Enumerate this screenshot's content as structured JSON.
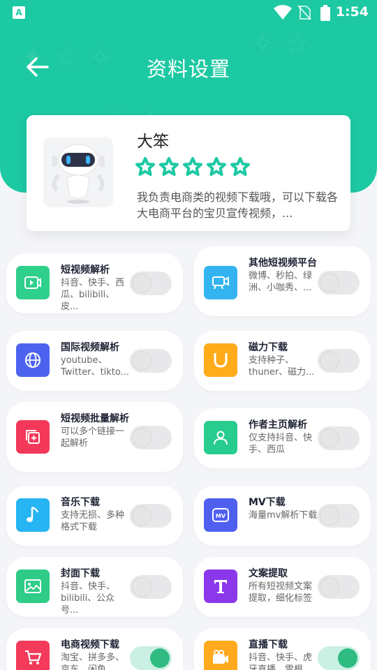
{
  "status_bar": {
    "time": "1:54",
    "app_badge": "A"
  },
  "header": {
    "title": "资料设置"
  },
  "profile": {
    "name": "大笨",
    "rating": 5,
    "description": "我负责电商类的视频下载哦，可以下载各大电商平台的宝贝宣传视频，..."
  },
  "colors": {
    "accent": "#1dc9a2",
    "toggle_on": "#2fbb82"
  },
  "features": [
    {
      "title": "短视频解析",
      "desc": "抖音、快手、西瓜、bilibili、皮...",
      "icon": "video-play-icon",
      "color": "#2fcf8c",
      "enabled": false
    },
    {
      "title": "其他短视频平台",
      "desc": "微博、秒拍、绿洲、小咖秀、...",
      "icon": "camera-icon",
      "color": "#33b4f0",
      "enabled": false
    },
    {
      "title": "国际视频解析",
      "desc": "youtube、Twitter、tikto...",
      "icon": "globe-icon",
      "color": "#4d63f0",
      "enabled": false
    },
    {
      "title": "磁力下载",
      "desc": "支持种子、thuner、磁力...",
      "icon": "magnet-icon",
      "color": "#ffab1a",
      "enabled": false
    },
    {
      "title": "短视频批量解析",
      "desc": "可以多个链接一起解析",
      "icon": "batch-add-icon",
      "color": "#f33859",
      "enabled": false
    },
    {
      "title": "作者主页解析",
      "desc": "仅支持抖音、快手、西瓜",
      "icon": "user-icon",
      "color": "#27cc8e",
      "enabled": false
    },
    {
      "title": "音乐下载",
      "desc": "支持无损、多种格式下载",
      "icon": "music-note-icon",
      "color": "#27b4f2",
      "enabled": false
    },
    {
      "title": "MV下载",
      "desc": "海量mv解析下载",
      "icon": "mv-icon",
      "color": "#4f60ee",
      "enabled": false
    },
    {
      "title": "封面下载",
      "desc": "抖音、快手、bilibili、公众号...",
      "icon": "image-icon",
      "color": "#2ecc87",
      "enabled": false
    },
    {
      "title": "文案提取",
      "desc": "所有短视频文案提取，细化标签",
      "icon": "text-icon",
      "color": "#8b38ea",
      "enabled": false
    },
    {
      "title": "电商视频下载",
      "desc": "淘宝、拼多多、京东、闲鱼...",
      "icon": "cart-icon",
      "color": "#f33a5a",
      "enabled": true
    },
    {
      "title": "直播下载",
      "desc": "抖音、快手、虎牙直播、雪根...",
      "icon": "live-video-icon",
      "color": "#ffaa1e",
      "enabled": true
    }
  ]
}
